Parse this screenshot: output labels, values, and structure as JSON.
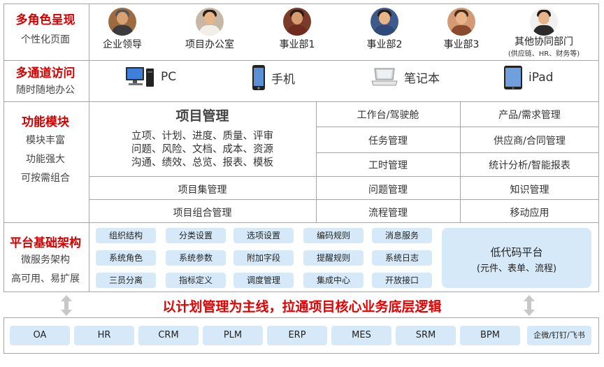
{
  "roles_section": {
    "title": "多角色呈现",
    "subtitle": "个性化页面"
  },
  "roles": [
    {
      "label": "企业领导",
      "sub": "",
      "icon": "person-photo-leader"
    },
    {
      "label": "项目办公室",
      "sub": "",
      "icon": "person-photo-office"
    },
    {
      "label": "事业部1",
      "sub": "",
      "icon": "person-photo-division"
    },
    {
      "label": "事业部2",
      "sub": "",
      "icon": "person-photo-division"
    },
    {
      "label": "事业部3",
      "sub": "",
      "icon": "person-photo-division"
    },
    {
      "label": "其他协同部门",
      "sub": "(供应链、HR、财务等)",
      "icon": "person-photo-other"
    }
  ],
  "access_section": {
    "title": "多通道访问",
    "subtitle": "随时随地办公"
  },
  "devices": [
    {
      "label": "PC",
      "icon": "desktop-pc-icon"
    },
    {
      "label": "手机",
      "icon": "mobile-phone-icon"
    },
    {
      "label": "笔记本",
      "icon": "laptop-icon"
    },
    {
      "label": "iPad",
      "icon": "tablet-icon"
    }
  ],
  "modules_section": {
    "title": "功能模块",
    "sub1": "模块丰富",
    "sub2": "功能强大",
    "sub3": "可按需组合"
  },
  "project_mgmt": {
    "title": "项目管理",
    "lines": [
      "立项、计划、进度、质量、评审",
      "问题、风险、文档、成本、资源",
      "沟通、绩效、总览、报表、模板"
    ]
  },
  "left_cells": [
    "项目集管理",
    "项目组合管理"
  ],
  "mid_cells": [
    "工作台/驾驶舱",
    "任务管理",
    "工时管理",
    "问题管理",
    "流程管理"
  ],
  "right_cells": [
    "产品/需求管理",
    "供应商/合同管理",
    "统计分析/智能报表",
    "知识管理",
    "移动应用"
  ],
  "platform_section": {
    "title": "平台基础架构",
    "sub1": "微服务架构",
    "sub2": "高可用、易扩展"
  },
  "platform_items": [
    [
      "组织结构",
      "分类设置",
      "选项设置",
      "编码规则",
      "消息服务"
    ],
    [
      "系统角色",
      "系统参数",
      "附加字段",
      "提醒规则",
      "系统日志"
    ],
    [
      "三员分离",
      "指标定义",
      "调度管理",
      "集成中心",
      "开放接口"
    ]
  ],
  "lowcode": {
    "title": "低代码平台",
    "subtitle": "(元件、表单、流程)"
  },
  "banner": "以计划管理为主线，拉通项目核心业务底层逻辑",
  "systems": [
    "OA",
    "HR",
    "CRM",
    "PLM",
    "ERP",
    "MES",
    "SRM",
    "BPM",
    "企微/钉钉/飞书"
  ],
  "colors": {
    "accent_red": "#d40000",
    "pill_blue": "#d6e9f8",
    "border_gray": "#a6a6a6"
  }
}
